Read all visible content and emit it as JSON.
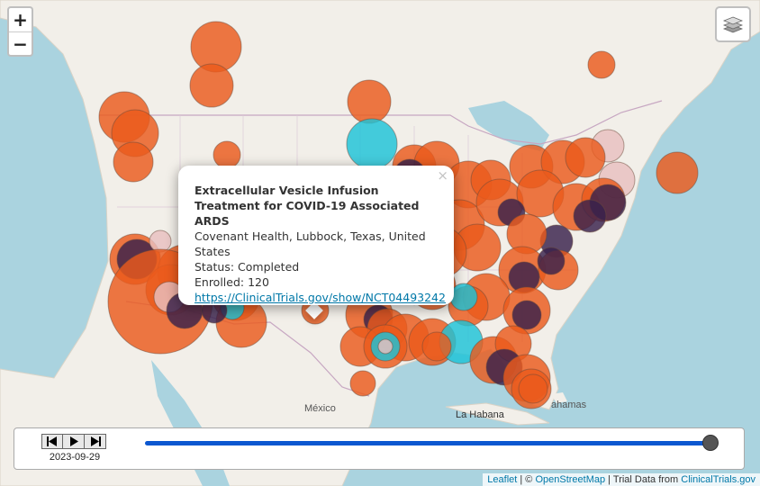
{
  "map": {
    "places": {
      "mexico": "México",
      "havana": "La Habana",
      "bahamas": "ahamas"
    },
    "colors": {
      "land": "#f2efe9",
      "water": "#aad3df",
      "border": "#c7a7c2",
      "recruiting": "#ea5a1c",
      "completed": "#38214c",
      "active": "#1cc3d8",
      "other": "#e8bfc0"
    },
    "marker_status_by_color": {
      "#ea5a1c": "orange",
      "#38214c": "dark purple",
      "#1cc3d8": "cyan",
      "#e8bfc0": "light pink"
    }
  },
  "controls": {
    "zoom_in": "+",
    "zoom_out": "−",
    "layers_icon": "layers-icon"
  },
  "popup": {
    "title": "Extracellular Vesicle Infusion Treatment for COVID-19 Associated ARDS",
    "location": "Covenant Health, Lubbock, Texas, United States",
    "status": "Status: Completed",
    "enrolled": "Enrolled: 120",
    "link": "https://ClinicalTrials.gov/show/NCT04493242",
    "close": "×"
  },
  "timeline": {
    "date": "2023-09-29",
    "progress": 1.0,
    "buttons": [
      "skip-back-icon",
      "play-icon",
      "skip-forward-icon"
    ]
  },
  "attribution": {
    "leaflet": "Leaflet",
    "sep1": " | © ",
    "osm": "OpenStreetMap",
    "sep2": " | Trial Data from ",
    "ct": "ClinicalTrials.gov"
  }
}
